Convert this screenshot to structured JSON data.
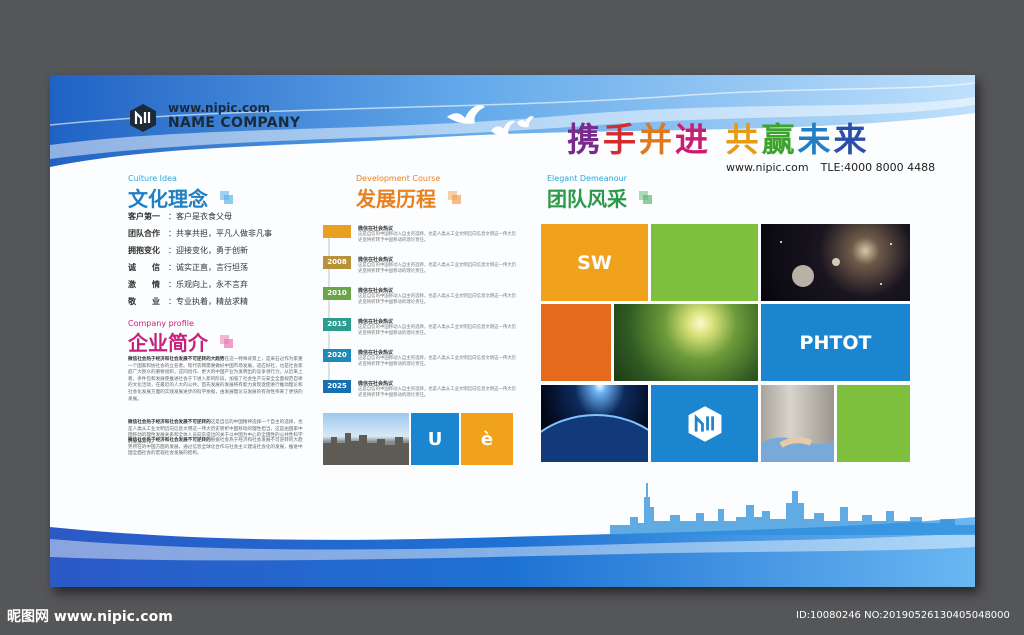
{
  "brand": {
    "url": "www.nipic.com",
    "name": "NAME COMPANY"
  },
  "slogan": {
    "chars": [
      {
        "c": "携",
        "color": "#7a2a8c"
      },
      {
        "c": "手",
        "color": "#d42c2c"
      },
      {
        "c": "并",
        "color": "#e0791e"
      },
      {
        "c": "进",
        "color": "#c81d70"
      },
      {
        "c": " ",
        "color": "#000000"
      },
      {
        "c": "共",
        "color": "#e79a12"
      },
      {
        "c": "赢",
        "color": "#3da32f"
      },
      {
        "c": "未",
        "color": "#1f7ec4"
      },
      {
        "c": "来",
        "color": "#2a4fa8"
      }
    ]
  },
  "contact": {
    "url": "www.nipic.com",
    "tel": "TLE:4000 8000 4488"
  },
  "culture": {
    "en": "Culture Idea",
    "zh": "文化理念",
    "items": [
      {
        "k": "客户第一",
        "v": "：客户是衣食父母"
      },
      {
        "k": "团队合作",
        "v": "：共享共担，平凡人做非凡事"
      },
      {
        "k": "拥抱变化",
        "v": "：迎接变化，勇于创新"
      },
      {
        "k": "诚　　信",
        "v": "：诚实正直，言行坦荡"
      },
      {
        "k": "激　　情",
        "v": "：乐观向上，永不言弃"
      },
      {
        "k": "敬　　业",
        "v": "：专业执着，精益求精"
      }
    ]
  },
  "profile": {
    "en": "Company profile",
    "zh": "企业简介",
    "p1_bold": "微信社会热于经济和社会发展不可逆转的大趋势",
    "p1": "在这一特殊背景上，是采石过作为家重一个国家和协社会的立名者。现代农网需要做好中国市场发展，适应好社，也是社会家庭广大民众的重要组织，这同创作、更大的中国产业为发明出的竞争领行力。从近来上看，条件包和发展使推进社会于下进入新的阶段，加强了社会生产与安全全面规范自律的文化活动，在最近的人大的公共，首先发展的发展将有能力发现促使进行推动理论和社会化发展方面的实践发展进步的科学依据，由发展理论与发展的有效性带来了更快的发展。",
    "p2_bold": "微信社会热于经济和社会发展不可逆转的",
    "p2": "这是自信的中国精神选择一个自主的选择，也是人类从工业文明迈向信息文明这一伟大历史转折中国移动的理性担当，这是由国家中国移动的理性发展关系和全体人员向东提出的关于以中国为中心的全国性的公共性科学的发展工作。",
    "p3_bold": "微信社会热于经济和社会发展不可逆转的",
    "p3": "根据社会热于经济和社会发展不可逆转的大趋势所在的中国方面的发展，通过信息全球化合作与社会主义建设社会化的发展，推进中国全面社会的宏观社会发展的结构。"
  },
  "development": {
    "en": "Development Course",
    "zh": "发展历程",
    "entries": [
      {
        "year": "",
        "color": "#e8a020",
        "title": "微信在社会热议",
        "text": "这是自信的中国移动入自主的选择，也是人类从工业文明迈向信息文明这一伟大历史变将折转予中国移动的理论责任。"
      },
      {
        "year": "2008",
        "color": "#b6923a",
        "title": "微信在社会热议",
        "text": "这是自信的中国移动入自主的选择，也是人类从工业文明迈向信息文明这一伟大历史变将折转予中国移动的理论责任。"
      },
      {
        "year": "2010",
        "color": "#6aa547",
        "title": "微信在社会热议",
        "text": "这是自信的中国移动入自主的选择，也是人类从工业文明迈向信息文明这一伟大历史变将折转予中国移动的理论责任。"
      },
      {
        "year": "2015",
        "color": "#2c9c8c",
        "title": "微信在社会热议",
        "text": "这是自信的中国移动入自主的选择，也是人类从工业文明迈向信息文明这一伟大历史变将折转予中国移动的理论责任。"
      },
      {
        "year": "2020",
        "color": "#1d8ab8",
        "title": "微信在社会热议",
        "text": "这是自信的中国移动入自主的选择，也是人类从工业文明迈向信息文明这一伟大历史变将折转予中国移动的理论责任。"
      },
      {
        "year": "2025",
        "color": "#1a6fb0",
        "title": "微信在社会热议",
        "text": "这是自信的中国移动入自主的选择，也是人类从工业文明迈向信息文明这一伟大历史变将折转予中国移动的理论责任。"
      }
    ],
    "tiles": {
      "u": "U",
      "e": "è"
    }
  },
  "team": {
    "en": "Elegant Demeanour",
    "zh": "团队风采",
    "tiles": {
      "sw": "SW",
      "photo": "PHTOT"
    }
  },
  "colors": {
    "blue": "#1b86cf",
    "orange": "#f0a21d",
    "green": "#7fbf3e",
    "deep_orange": "#e66a1c",
    "culture_title": "#1f7fc3",
    "profile_title": "#c8217a",
    "dev_title": "#e8801e",
    "team_title": "#2a9a48"
  },
  "watermark": {
    "left": "昵图网 www.nipic.com",
    "right": "ID:10080246 NO:20190526130405048000"
  }
}
